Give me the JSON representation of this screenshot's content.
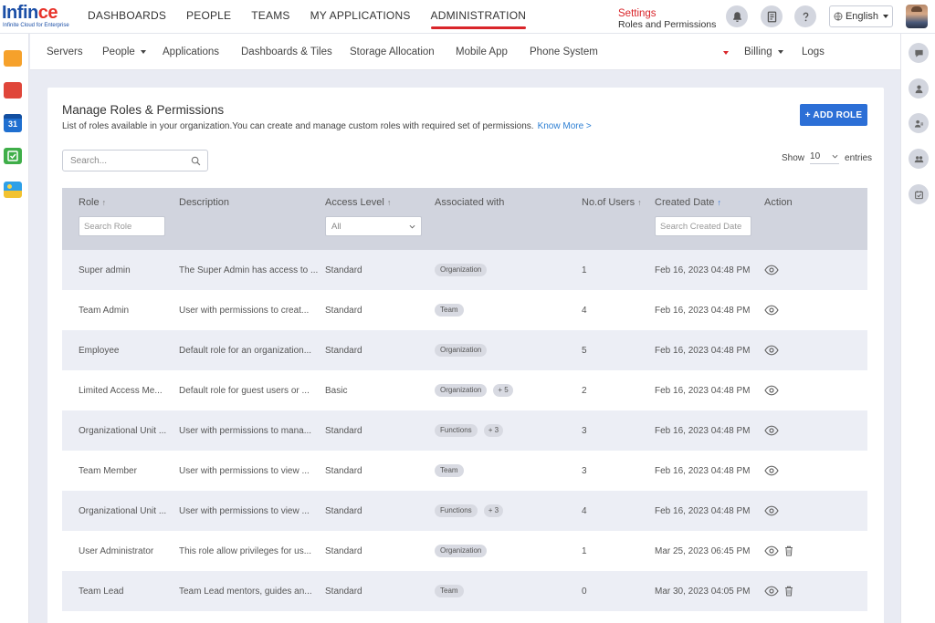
{
  "brand": {
    "name_part1": "Inf",
    "name_part2": "in",
    "name_part3": "c",
    "name_part4": "e",
    "tagline": "Infinite Cloud for Enterprise"
  },
  "top_nav": [
    "DASHBOARDS",
    "PEOPLE",
    "TEAMS",
    "MY APPLICATIONS",
    "ADMINISTRATION"
  ],
  "top_nav_active": "ADMINISTRATION",
  "language": "English",
  "sub_nav": {
    "servers": "Servers",
    "people": "People",
    "applications": "Applications",
    "dashboards": "Dashboards & Tiles",
    "storage": "Storage Allocation",
    "mobile": "Mobile App",
    "phone": "Phone System",
    "settings_title": "Settings",
    "settings_sub": "Roles and Permissions",
    "billing": "Billing",
    "logs": "Logs"
  },
  "page": {
    "title": "Manage Roles & Permissions",
    "description": "List of roles available in your organization.You can create and manage custom roles with required set of permissions.",
    "know_more": "Know More >",
    "add_role": "+ ADD ROLE",
    "search_placeholder": "Search...",
    "show_label": "Show",
    "show_value": "10",
    "entries_label": "entries"
  },
  "table": {
    "headers": {
      "role": "Role",
      "description": "Description",
      "access": "Access Level",
      "associated": "Associated with",
      "users": "No.of Users",
      "created": "Created Date",
      "action": "Action"
    },
    "filters": {
      "role_placeholder": "Search Role",
      "access_value": "All",
      "created_placeholder": "Search Created Date"
    },
    "rows": [
      {
        "role": "Super admin",
        "description": "The Super Admin has access to ...",
        "access": "Standard",
        "chips": [
          "Organization"
        ],
        "users": "1",
        "created": "Feb 16, 2023 04:48 PM",
        "delete": false
      },
      {
        "role": "Team Admin",
        "description": "User with permissions to creat...",
        "access": "Standard",
        "chips": [
          "Team"
        ],
        "users": "4",
        "created": "Feb 16, 2023 04:48 PM",
        "delete": false
      },
      {
        "role": "Employee",
        "description": "Default role for an organization...",
        "access": "Standard",
        "chips": [
          "Organization"
        ],
        "users": "5",
        "created": "Feb 16, 2023 04:48 PM",
        "delete": false
      },
      {
        "role": "Limited Access Me...",
        "description": "Default role for guest users or ...",
        "access": "Basic",
        "chips": [
          "Organization",
          "+ 5"
        ],
        "users": "2",
        "created": "Feb 16, 2023 04:48 PM",
        "delete": false
      },
      {
        "role": "Organizational Unit ...",
        "description": "User with permissions to mana...",
        "access": "Standard",
        "chips": [
          "Functions",
          "+ 3"
        ],
        "users": "3",
        "created": "Feb 16, 2023 04:48 PM",
        "delete": false
      },
      {
        "role": "Team Member",
        "description": "User with permissions to view ...",
        "access": "Standard",
        "chips": [
          "Team"
        ],
        "users": "3",
        "created": "Feb 16, 2023 04:48 PM",
        "delete": false
      },
      {
        "role": "Organizational Unit ...",
        "description": "User with permissions to view ...",
        "access": "Standard",
        "chips": [
          "Functions",
          "+ 3"
        ],
        "users": "4",
        "created": "Feb 16, 2023 04:48 PM",
        "delete": false
      },
      {
        "role": "User Administrator",
        "description": "This role allow privileges for us...",
        "access": "Standard",
        "chips": [
          "Organization"
        ],
        "users": "1",
        "created": "Mar 25, 2023 06:45 PM",
        "delete": true
      },
      {
        "role": "Team Lead",
        "description": "Team Lead mentors, guides an...",
        "access": "Standard",
        "chips": [
          "Team"
        ],
        "users": "0",
        "created": "Mar 30, 2023 04:05 PM",
        "delete": true
      }
    ]
  },
  "colors": {
    "accent": "#2c6fd6",
    "brand_red": "#d9252a",
    "brand_blue": "#1a4ea6"
  }
}
